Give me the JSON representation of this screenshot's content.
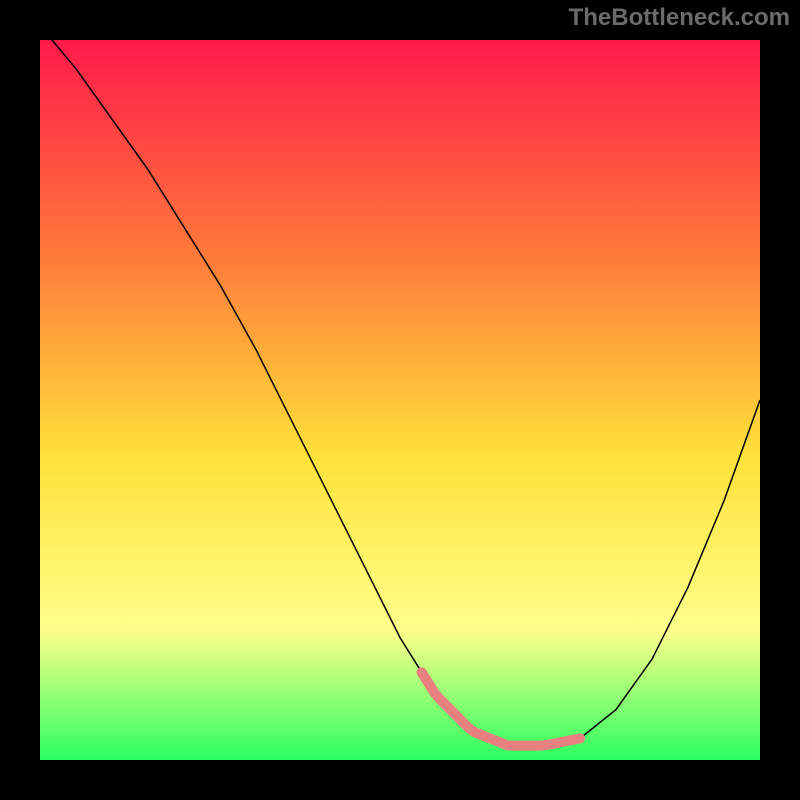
{
  "watermark": "TheBottleneck.com",
  "colors": {
    "gradient_top": "#ff1a4a",
    "gradient_mid_upper": "#ff7a3a",
    "gradient_mid": "#ffe23a",
    "gradient_mid_lower": "#ffff8a",
    "gradient_bottom": "#2aff60",
    "curve": "#000000",
    "accent": "#e98080",
    "frame": "#000000",
    "watermark_text": "#6b6b6b"
  },
  "chart_data": {
    "type": "line",
    "title": "",
    "xlabel": "",
    "ylabel": "",
    "xlim": [
      0,
      100
    ],
    "ylim": [
      0,
      100
    ],
    "x": [
      0,
      5,
      10,
      15,
      20,
      25,
      30,
      35,
      40,
      45,
      50,
      55,
      60,
      65,
      70,
      75,
      80,
      85,
      90,
      95,
      100
    ],
    "values": [
      102,
      96,
      89,
      82,
      74,
      66,
      57,
      47,
      37,
      27,
      17,
      9,
      4,
      2,
      2,
      3,
      7,
      14,
      24,
      36,
      50
    ],
    "accent_range_x": [
      53,
      75
    ],
    "annotations": []
  }
}
